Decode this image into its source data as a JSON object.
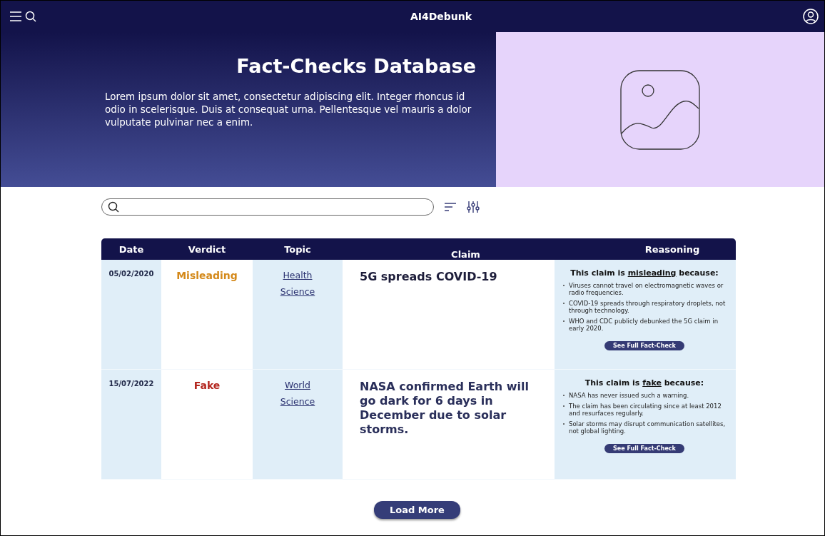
{
  "top_bar": {
    "brand": "AI4Debunk"
  },
  "hero": {
    "title": "Fact-Checks Database",
    "text": "Lorem ipsum dolor sit amet, consectetur adipiscing elit. Integer rhoncus id odio in scelerisque. Duis at consequat urna. Pellentesque vel mauris a dolor vulputate pulvinar nec a enim."
  },
  "table": {
    "columns": [
      "Date",
      "Verdict",
      "Topic",
      "Claim",
      "Reasoning"
    ],
    "rows": [
      {
        "date": "05/02/2020",
        "verdict": "Misleading",
        "color": "#d4891a",
        "topics": [
          "Health",
          "Science"
        ],
        "claim": "5G spreads COVID-19",
        "reasoning": {
          "lead": "This claim is",
          "term": "misleading",
          "tail": "because:",
          "points": [
            "Viruses cannot travel on electromagnetic waves or radio frequencies.",
            "COVID-19 spreads through respiratory droplets, not through technology.",
            "WHO and CDC publicly debunked the 5G claim in early 2020."
          ],
          "button": "See Full Fact-Check"
        }
      },
      {
        "date": "15/07/2022",
        "verdict": "Fake",
        "color": "#b3261e",
        "topics": [
          "World",
          "Science"
        ],
        "claim": "NASA confirmed Earth will go dark for 6 days in December due to solar storms.",
        "reasoning": {
          "lead": "This claim is",
          "term": "fake",
          "tail": "because:",
          "points": [
            "NASA has never issued such a warning.",
            "The claim has been circulating since at least 2012 and resurfaces regularly.",
            "Solar storms may disrupt communication satellites, not global lighting."
          ],
          "button": "See Full Fact-Check"
        }
      }
    ]
  },
  "load_more": "Load More"
}
